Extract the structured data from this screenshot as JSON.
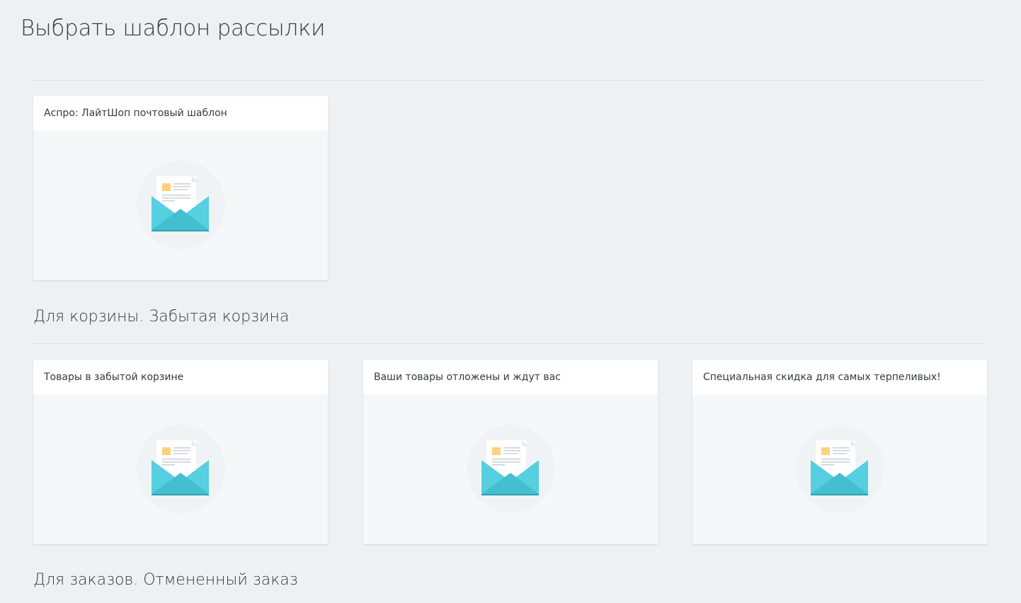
{
  "page": {
    "title": "Выбрать шаблон рассылки"
  },
  "sections": [
    {
      "heading": "",
      "templates": [
        {
          "title": "Аспро: ЛайтШоп почтовый шаблон",
          "icon": "envelope-letter-icon"
        }
      ]
    },
    {
      "heading": "Для корзины. Забытая корзина",
      "templates": [
        {
          "title": "Товары в забытой корзине",
          "icon": "envelope-letter-icon"
        },
        {
          "title": "Ваши товары отложены и ждут вас",
          "icon": "envelope-letter-icon"
        },
        {
          "title": "Специальная скидка для самых терпеливых!",
          "icon": "envelope-letter-icon"
        }
      ]
    },
    {
      "heading": "Для заказов. Отмененный заказ",
      "templates": []
    }
  ],
  "colors": {
    "background": "#eef1f4",
    "card_body": "#f5f8f9",
    "envelope_light": "#56cfe0",
    "envelope_dark": "#44bfd2",
    "letter_stamp": "#fdd27f"
  }
}
